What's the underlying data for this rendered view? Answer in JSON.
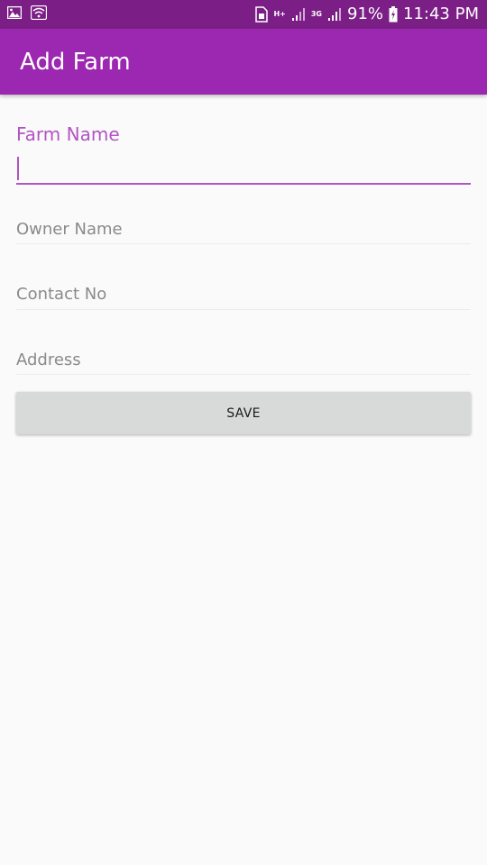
{
  "status_bar": {
    "network_plus_label": "H+",
    "network_3g_label": "3G",
    "battery": "91%",
    "time": "11:43 PM",
    "icons": [
      "image-icon",
      "wifi-icon",
      "sim-icon",
      "signal-icon",
      "battery-charging-icon"
    ]
  },
  "app_bar": {
    "title": "Add Farm",
    "color": "#9c27b0"
  },
  "form": {
    "farm_name_label": "Farm Name",
    "farm_name_value": "",
    "owner_name_placeholder": "Owner Name",
    "contact_no_placeholder": "Contact No",
    "address_placeholder": "Address",
    "save_label": "SAVE",
    "accent_color": "#b254c2"
  }
}
